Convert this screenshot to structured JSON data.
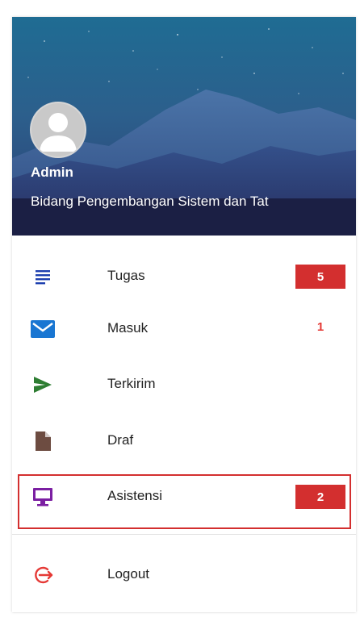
{
  "user": {
    "name": "Admin",
    "unit": "Bidang Pengembangan Sistem dan Tat"
  },
  "menu": {
    "items": [
      {
        "label": "Tugas",
        "icon": "list-icon",
        "badge": "5",
        "badge_style": "filled"
      },
      {
        "label": "Masuk",
        "icon": "mail-icon",
        "badge": "1",
        "badge_style": "text"
      },
      {
        "label": "Terkirim",
        "icon": "send-icon"
      },
      {
        "label": "Draf",
        "icon": "file-icon"
      },
      {
        "label": "Asistensi",
        "icon": "monitor-icon",
        "badge": "2",
        "badge_style": "filled",
        "highlighted": true
      }
    ],
    "logout": {
      "label": "Logout",
      "icon": "logout-icon"
    }
  },
  "colors": {
    "badge": "#d32f2f",
    "list_icon": "#1e40af",
    "mail_icon": "#1976d2",
    "send_icon": "#2e7d32",
    "file_icon": "#6d4c41",
    "monitor_icon": "#7b1fa2",
    "logout_icon": "#e53935",
    "header_dark": "#1b1f44"
  }
}
